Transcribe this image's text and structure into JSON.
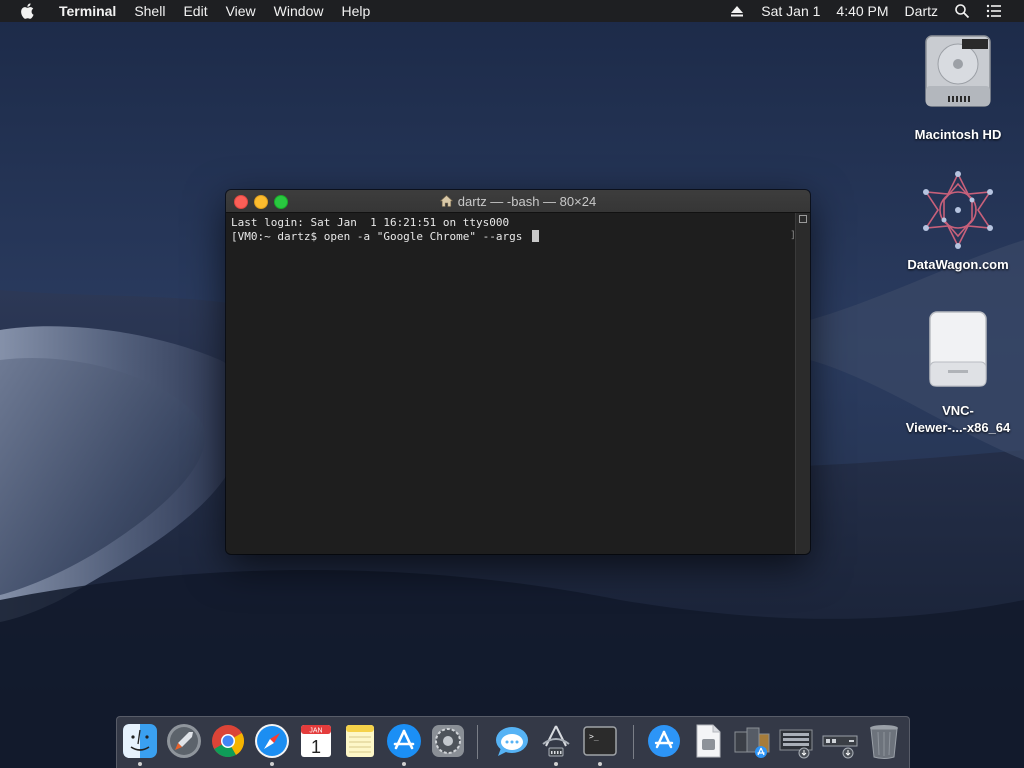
{
  "menubar": {
    "app_name": "Terminal",
    "items": [
      "Shell",
      "Edit",
      "View",
      "Window",
      "Help"
    ],
    "date": "Sat Jan 1",
    "time": "4:40 PM",
    "user": "Dartz"
  },
  "desktop_icons": [
    {
      "label": "Macintosh HD"
    },
    {
      "label": "DataWagon.com"
    },
    {
      "label_line1": "VNC-",
      "label_line2": "Viewer-...-x86_64"
    }
  ],
  "terminal": {
    "title": "dartz — -bash — 80×24",
    "lines": [
      "Last login: Sat Jan  1 16:21:51 on ttys000",
      "[VM0:~ dartz$ open -a \"Google Chrome\" --args "
    ]
  },
  "dock": {
    "calendar_month": "JAN",
    "calendar_day": "1",
    "terminal_prompt": ">_",
    "items": [
      {
        "icon": "finder-icon",
        "running": true
      },
      {
        "icon": "launchpad-icon",
        "running": false
      },
      {
        "icon": "chrome-icon",
        "running": false
      },
      {
        "icon": "safari-icon",
        "running": true
      },
      {
        "icon": "calendar-icon",
        "running": false
      },
      {
        "icon": "notes-icon",
        "running": false
      },
      {
        "icon": "app-store-icon",
        "running": true
      },
      {
        "icon": "system-preferences-icon",
        "running": false
      },
      {
        "icon": "messages-icon",
        "running": false
      },
      {
        "icon": "network-utility-icon",
        "running": true
      },
      {
        "icon": "terminal-icon",
        "running": true
      },
      {
        "icon": "app-store-folder-icon",
        "running": false
      },
      {
        "icon": "document-icon",
        "running": false
      },
      {
        "icon": "applications-stack-icon",
        "running": false
      },
      {
        "icon": "downloads-stack-icon",
        "running": false
      },
      {
        "icon": "server-stack-icon",
        "running": false
      },
      {
        "icon": "trash-icon",
        "running": false
      }
    ]
  }
}
